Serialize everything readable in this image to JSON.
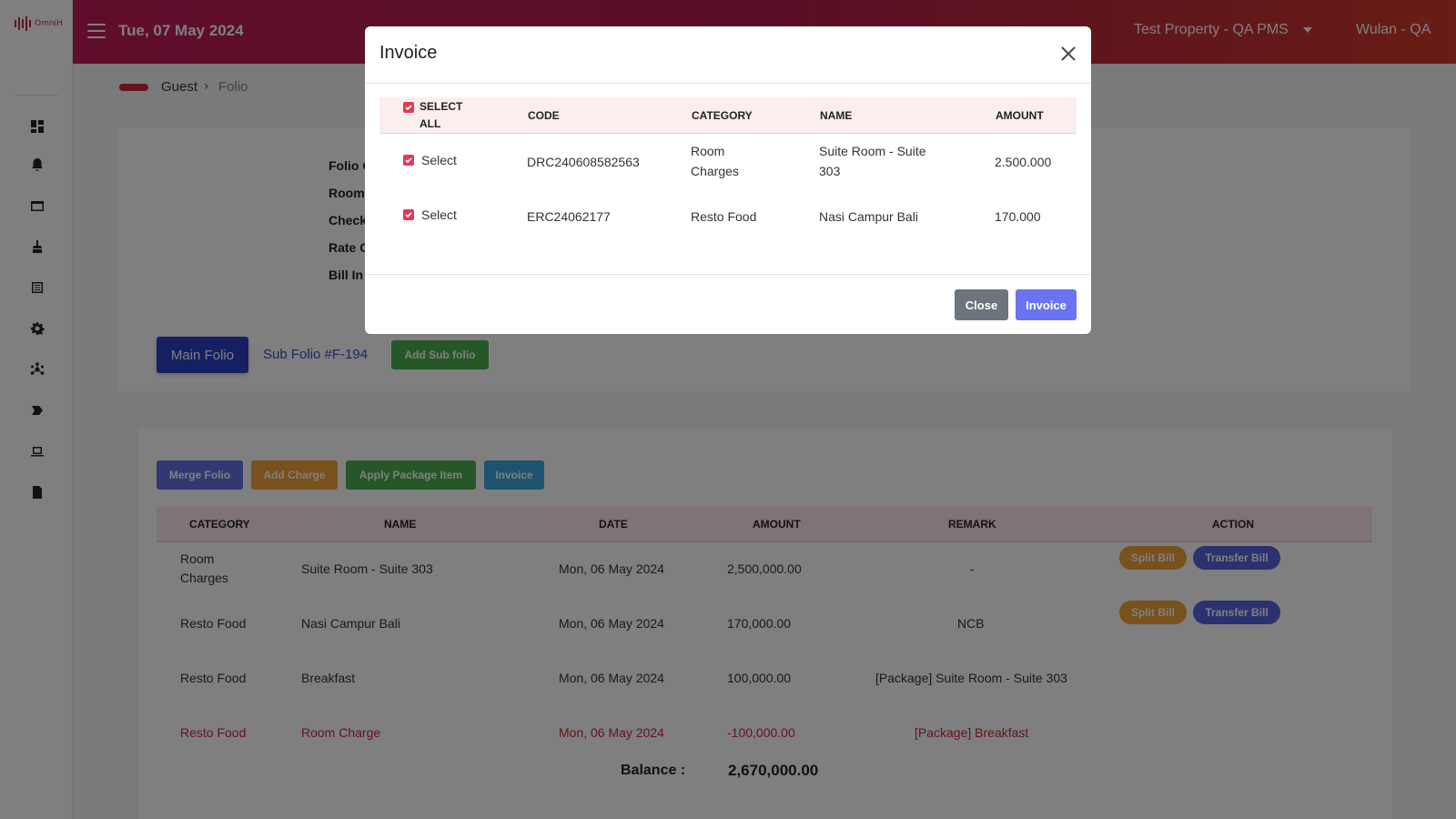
{
  "app": {
    "logo_text": "OmniH"
  },
  "header": {
    "date": "Tue, 07 May 2024",
    "property": "Test Property - QA PMS",
    "user": "Wulan - QA"
  },
  "breadcrumb": {
    "guest": "Guest",
    "separator": "›",
    "folio": "Folio"
  },
  "sidebar": {
    "items": [
      {
        "icon": "dashboard-icon"
      },
      {
        "icon": "notifications-icon"
      },
      {
        "icon": "folder-icon"
      },
      {
        "icon": "housekeeping-icon"
      },
      {
        "icon": "list-icon"
      },
      {
        "icon": "settings-icon"
      },
      {
        "icon": "network-icon"
      },
      {
        "icon": "tag-icon"
      },
      {
        "icon": "laptop-icon"
      },
      {
        "icon": "report-icon"
      }
    ]
  },
  "info": {
    "labels": [
      "Folio C",
      "Room",
      "Check",
      "Rate C",
      "Bill In"
    ]
  },
  "folio_tabs": {
    "main": "Main Folio",
    "sub": "Sub Folio #F-194",
    "add_sub": "Add Sub folio"
  },
  "actions": {
    "merge": "Merge Folio",
    "add_charge": "Add Charge",
    "apply_package": "Apply Package Item",
    "invoice": "Invoice"
  },
  "table": {
    "headers": {
      "category": "CATEGORY",
      "name": "NAME",
      "date": "DATE",
      "amount": "AMOUNT",
      "remark": "REMARK",
      "action": "ACTION"
    },
    "rows": [
      {
        "category": "Room Charges",
        "name": "Suite Room - Suite 303",
        "date": "Mon, 06 May 2024",
        "amount": "2,500,000.00",
        "remark": "-",
        "split": "Split Bill",
        "transfer": "Transfer Bill"
      },
      {
        "category": "Resto Food",
        "name": "Nasi Campur Bali",
        "date": "Mon, 06 May 2024",
        "amount": "170,000.00",
        "remark": "NCB",
        "split": "Split Bill",
        "transfer": "Transfer Bill"
      },
      {
        "category": "Resto Food",
        "name": "Breakfast",
        "date": "Mon, 06 May 2024",
        "amount": "100,000.00",
        "remark": "[Package] Suite Room - Suite 303"
      },
      {
        "category": "Resto Food",
        "name": "Room Charge",
        "date": "Mon, 06 May 2024",
        "amount": "-100,000.00",
        "remark": "[Package] Breakfast"
      }
    ],
    "balance_label": "Balance :",
    "balance_value": "2,670,000.00"
  },
  "modal": {
    "title": "Invoice",
    "headers": {
      "select_all": "SELECT ALL",
      "code": "CODE",
      "category": "CATEGORY",
      "name": "NAME",
      "amount": "AMOUNT"
    },
    "rows": [
      {
        "select": "Select",
        "code": "DRC240608582563",
        "category": "Room Charges",
        "name": "Suite Room - Suite 303",
        "amount": "2.500.000",
        "checked": true
      },
      {
        "select": "Select",
        "code": "ERC24062177",
        "category": "Resto Food",
        "name": "Nasi Campur Bali",
        "amount": "170.000",
        "checked": true
      }
    ],
    "close_label": "Close",
    "invoice_label": "Invoice"
  },
  "colors": {
    "header_start": "#c21b5a",
    "header_end": "#d03a2a",
    "primary": "#2c3ec4",
    "accent_red": "#d0243c",
    "checkbox": "#e03a55"
  }
}
